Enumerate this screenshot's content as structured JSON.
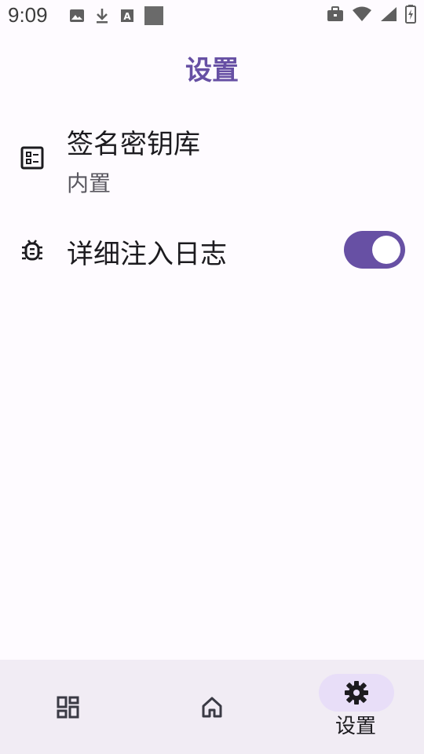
{
  "status_bar": {
    "time": "9:09",
    "left_icons": [
      "image-icon",
      "download-icon",
      "text-icon",
      "square-icon"
    ],
    "right_icons": [
      "briefcase-icon",
      "wifi-icon",
      "signal-icon",
      "battery-icon"
    ]
  },
  "app_bar": {
    "title": "设置"
  },
  "settings": {
    "keystore": {
      "title": "签名密钥库",
      "subtitle": "内置",
      "icon": "keystore-icon"
    },
    "verbose_log": {
      "title": "详细注入日志",
      "icon": "bug-icon",
      "enabled": true
    }
  },
  "bottom_nav": {
    "items": [
      {
        "icon": "apps-grid-icon",
        "label": ""
      },
      {
        "icon": "home-icon",
        "label": ""
      },
      {
        "icon": "settings-gear-icon",
        "label": "设置",
        "selected": true
      }
    ]
  },
  "colors": {
    "accent": "#6750a4",
    "background": "#fefbff",
    "nav_background": "#f1ecf4",
    "nav_indicator": "#e8def8"
  }
}
